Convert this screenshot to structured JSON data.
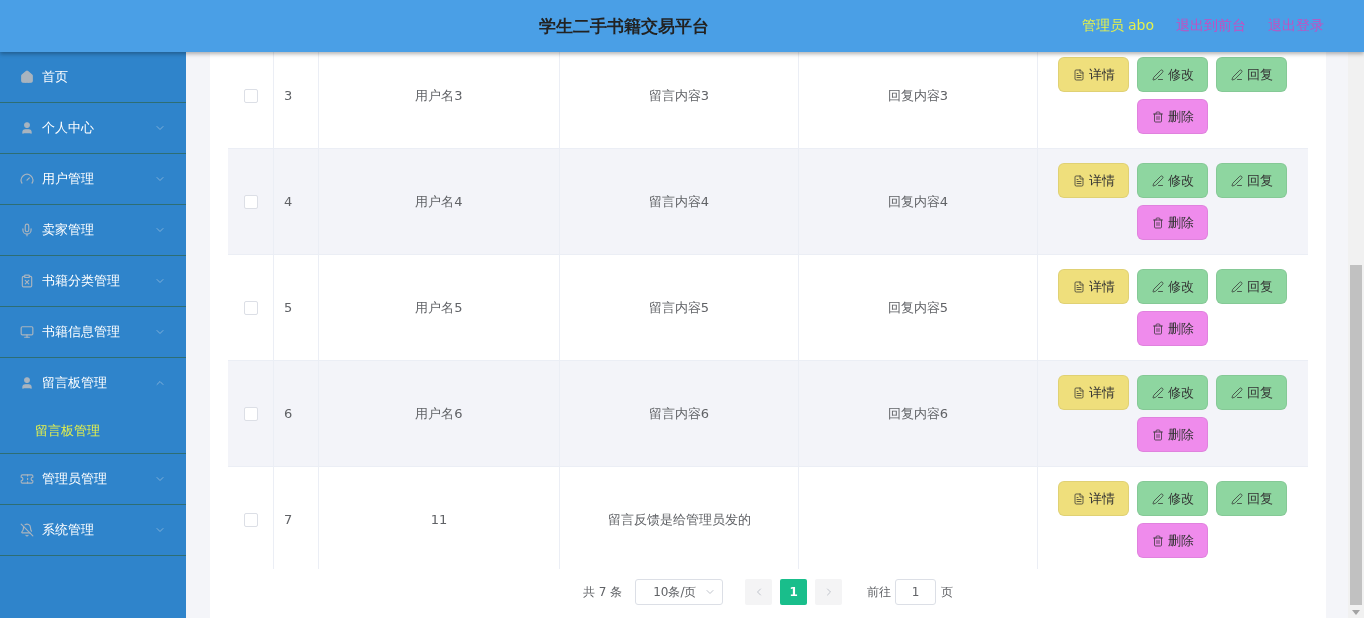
{
  "header": {
    "title": "学生二手书籍交易平台",
    "user_label": "管理员 abo",
    "links": [
      "退出到前台",
      "退出登录"
    ]
  },
  "sidebar": {
    "items": [
      {
        "kind": "home",
        "label": "首页"
      },
      {
        "kind": "person",
        "label": "个人中心",
        "expanded": false
      },
      {
        "kind": "gauge",
        "label": "用户管理",
        "expanded": false
      },
      {
        "kind": "mic",
        "label": "卖家管理",
        "expanded": false
      },
      {
        "kind": "clipboard",
        "label": "书籍分类管理",
        "expanded": false
      },
      {
        "kind": "monitor",
        "label": "书籍信息管理",
        "expanded": false
      },
      {
        "kind": "person",
        "label": "留言板管理",
        "expanded": true,
        "children": [
          {
            "label": "留言板管理",
            "selected": true
          }
        ]
      },
      {
        "kind": "ticket",
        "label": "管理员管理",
        "expanded": false
      },
      {
        "kind": "bell",
        "label": "系统管理",
        "expanded": false
      }
    ]
  },
  "table": {
    "rows": [
      {
        "checked": false,
        "index": "3",
        "username": "用户名3",
        "message": "留言内容3",
        "reply": "回复内容3",
        "actions": [
          {
            "kind": "detail",
            "label": "详情"
          },
          {
            "kind": "edit",
            "label": "修改"
          },
          {
            "kind": "reply",
            "label": "回复"
          },
          {
            "kind": "delete",
            "label": "删除"
          }
        ]
      },
      {
        "checked": false,
        "index": "4",
        "username": "用户名4",
        "message": "留言内容4",
        "reply": "回复内容4",
        "actions": [
          {
            "kind": "detail",
            "label": "详情"
          },
          {
            "kind": "edit",
            "label": "修改"
          },
          {
            "kind": "reply",
            "label": "回复"
          },
          {
            "kind": "delete",
            "label": "删除"
          }
        ]
      },
      {
        "checked": false,
        "index": "5",
        "username": "用户名5",
        "message": "留言内容5",
        "reply": "回复内容5",
        "actions": [
          {
            "kind": "detail",
            "label": "详情"
          },
          {
            "kind": "edit",
            "label": "修改"
          },
          {
            "kind": "reply",
            "label": "回复"
          },
          {
            "kind": "delete",
            "label": "删除"
          }
        ]
      },
      {
        "checked": false,
        "index": "6",
        "username": "用户名6",
        "message": "留言内容6",
        "reply": "回复内容6",
        "actions": [
          {
            "kind": "detail",
            "label": "详情"
          },
          {
            "kind": "edit",
            "label": "修改"
          },
          {
            "kind": "reply",
            "label": "回复"
          },
          {
            "kind": "delete",
            "label": "删除"
          }
        ]
      },
      {
        "checked": false,
        "index": "7",
        "username": "11",
        "message": "留言反馈是给管理员发的",
        "actions": [
          {
            "kind": "detail",
            "label": "详情"
          },
          {
            "kind": "edit",
            "label": "修改"
          },
          {
            "kind": "reply",
            "label": "回复"
          },
          {
            "kind": "delete",
            "label": "删除"
          }
        ]
      }
    ]
  },
  "pagination": {
    "total": "共 7 条",
    "page_size": "10条/页",
    "prev_disabled": true,
    "next_disabled": true,
    "pages": [
      {
        "label": "1",
        "selected": true
      }
    ],
    "goto_label": "前往",
    "goto_value": "1",
    "goto_suffix": "页"
  }
}
